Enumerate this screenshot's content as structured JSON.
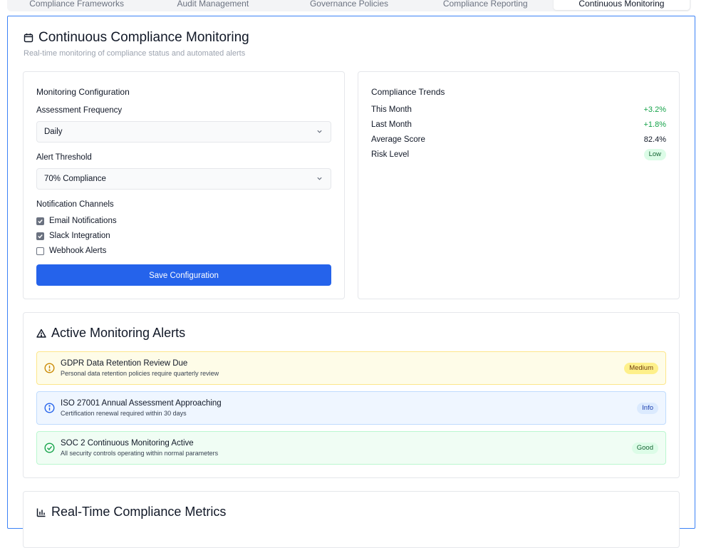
{
  "tabs": [
    {
      "label": "Compliance Frameworks"
    },
    {
      "label": "Audit Management"
    },
    {
      "label": "Governance Policies"
    },
    {
      "label": "Compliance Reporting"
    },
    {
      "label": "Continuous Monitoring"
    }
  ],
  "active_tab": "Continuous Monitoring",
  "header": {
    "title": "Continuous Compliance Monitoring",
    "subtitle": "Real-time monitoring of compliance status and automated alerts"
  },
  "config": {
    "title": "Monitoring Configuration",
    "frequency_label": "Assessment Frequency",
    "frequency_value": "Daily",
    "threshold_label": "Alert Threshold",
    "threshold_value": "70% Compliance",
    "channels_label": "Notification Channels",
    "channels": [
      {
        "label": "Email Notifications",
        "checked": true
      },
      {
        "label": "Slack Integration",
        "checked": true
      },
      {
        "label": "Webhook Alerts",
        "checked": false
      }
    ],
    "save_label": "Save Configuration"
  },
  "trends": {
    "title": "Compliance Trends",
    "rows": [
      {
        "label": "This Month",
        "value": "+3.2%"
      },
      {
        "label": "Last Month",
        "value": "+1.8%"
      },
      {
        "label": "Average Score",
        "value": "82.4%"
      },
      {
        "label": "Risk Level",
        "value": "Low"
      }
    ]
  },
  "alerts": {
    "title": "Active Monitoring Alerts",
    "items": [
      {
        "title": "GDPR Data Retention Review Due",
        "desc": "Personal data retention policies require quarterly review",
        "badge": "Medium",
        "icon": "warning-circle-icon"
      },
      {
        "title": "ISO 27001 Annual Assessment Approaching",
        "desc": "Certification renewal required within 30 days",
        "badge": "Info",
        "icon": "info-circle-icon"
      },
      {
        "title": "SOC 2 Continuous Monitoring Active",
        "desc": "All security controls operating within normal parameters",
        "badge": "Good",
        "icon": "check-circle-icon"
      }
    ]
  },
  "metrics": {
    "title": "Real-Time Compliance Metrics"
  },
  "colors": {
    "accent": "#2563eb",
    "panel_border": "#3b82f6",
    "positive": "#16a34a"
  }
}
